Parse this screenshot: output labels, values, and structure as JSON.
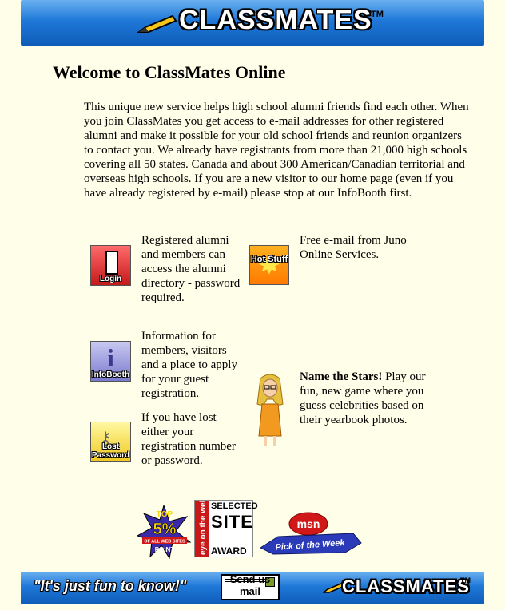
{
  "header": {
    "logo_text": "CLASSMATES",
    "tm": "TM"
  },
  "main": {
    "title": "Welcome to ClassMates Online",
    "intro": "This unique new service helps high school alumni friends find each other. When you join ClassMates you get access to e-mail addresses for other registered alumni and make it possible for your old school friends and reunion organizers to contact you. We already have registrants from more than 21,000 high schools covering all 50 states. Canada and about 300 American/Canadian territorial and overseas high schools. If you are a new visitor to our home page (even if you have already registered by e-mail) please stop at our InfoBooth first."
  },
  "links": {
    "login": {
      "icon_label": "Login",
      "description": "Registered alumni and members can access the alumni directory - password required."
    },
    "infobooth": {
      "icon_label": "InfoBooth",
      "icon_glyph": "i",
      "description": "Information for members, visitors and a place to apply for your guest registration."
    },
    "lost": {
      "icon_label": "Lost Password",
      "description": "If you have lost either your registration number or password."
    },
    "hot_stuff": {
      "icon_label": "Hot Stuff",
      "description": "Free e-mail from Juno Online Services."
    },
    "stars": {
      "bold": "Name the Stars!",
      "description": " Play our fun, new game where you guess celebrities based on their yearbook photos."
    }
  },
  "awards": {
    "top5": {
      "big": "TOP",
      "pct": "5%",
      "ribbon": "OF ALL WEB SITES",
      "brand": "POINT"
    },
    "eye": {
      "side": "eye on the web",
      "line1": "SELECTED",
      "line2": "SITE",
      "line3": "AWARD"
    },
    "msn": {
      "brand": "msn",
      "ribbon": "Pick of the Week"
    }
  },
  "footer": {
    "tagline": "\"It's just fun to know!\"",
    "mail_label": "Send us mail",
    "logo_text": "CLASSMATES",
    "tm": "TM"
  },
  "colors": {
    "background": "#fffee8",
    "banner": "#1f78d8"
  }
}
